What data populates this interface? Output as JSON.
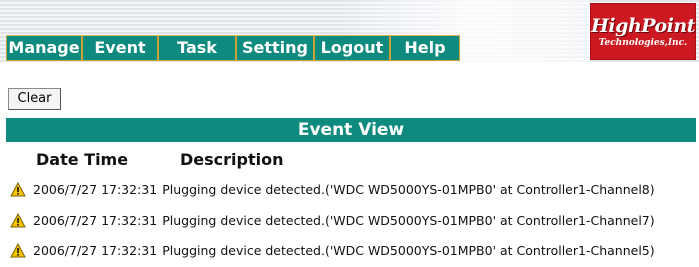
{
  "nav": {
    "items": [
      {
        "label": "Manage"
      },
      {
        "label": "Event"
      },
      {
        "label": "Task"
      },
      {
        "label": "Setting"
      },
      {
        "label": "Logout"
      },
      {
        "label": "Help"
      }
    ]
  },
  "logo": {
    "main": "HighPoint",
    "sub": "Technologies,Inc."
  },
  "toolbar": {
    "clear_label": "Clear"
  },
  "event_view": {
    "title": "Event View",
    "columns": {
      "datetime": "Date Time",
      "description": "Description"
    },
    "rows": [
      {
        "icon": "warning-icon",
        "datetime": "2006/7/27 17:32:31",
        "description": "Plugging device detected.('WDC WD5000YS-01MPB0' at Controller1-Channel8)"
      },
      {
        "icon": "warning-icon",
        "datetime": "2006/7/27 17:32:31",
        "description": "Plugging device detected.('WDC WD5000YS-01MPB0' at Controller1-Channel7)"
      },
      {
        "icon": "warning-icon",
        "datetime": "2006/7/27 17:32:31",
        "description": "Plugging device detected.('WDC WD5000YS-01MPB0' at Controller1-Channel5)"
      }
    ]
  },
  "colors": {
    "teal": "#0e8a7e",
    "nav_border": "#caa23a",
    "logo_red": "#cc1820",
    "warning_yellow": "#f5c400"
  }
}
